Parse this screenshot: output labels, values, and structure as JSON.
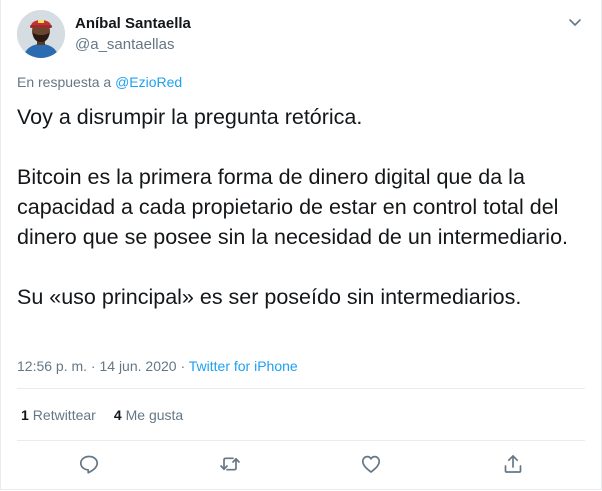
{
  "author": {
    "display_name": "Aníbal Santaella",
    "handle": "@a_santaellas"
  },
  "reply": {
    "prefix": "En respuesta a ",
    "mention": "@EzioRed"
  },
  "tweet": {
    "paragraphs": [
      "Voy a disrumpir la pregunta retórica.",
      "Bitcoin es la primera forma de dinero digital que da la capacidad a cada propietario de estar en control total del dinero que se posee sin la necesidad de un intermediario.",
      "Su «uso principal» es ser poseído sin intermediarios."
    ]
  },
  "meta": {
    "timestamp": "12:56 p. m. · 14 jun. 2020",
    "separator": " · ",
    "source": "Twitter for iPhone"
  },
  "stats": {
    "retweets_count": "1",
    "retweets_label": "Retwittear",
    "likes_count": "4",
    "likes_label": "Me gusta"
  },
  "icons": {
    "caret": "chevron-down-icon",
    "reply": "reply-icon",
    "retweet": "retweet-icon",
    "like": "heart-icon",
    "share": "share-icon"
  },
  "colors": {
    "link": "#1da1f2",
    "secondary_text": "#657786",
    "primary_text": "#14171a",
    "divider": "#e6ecf0"
  }
}
